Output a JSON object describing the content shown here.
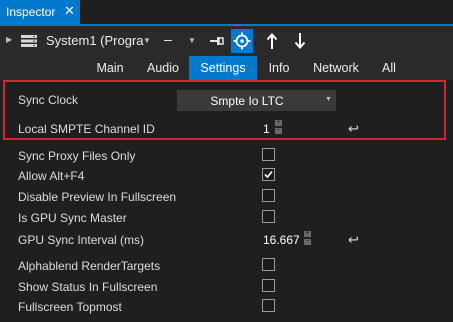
{
  "window": {
    "title": "Inspector",
    "close_glyph": "✕"
  },
  "toolbar": {
    "system_label": "System1 (Progra",
    "dash_label": "–",
    "icons": [
      "expand-arrow-icon",
      "device-icon",
      "dropdown-caret-icon",
      "pin-icon",
      "target-icon",
      "arrow-up-icon",
      "arrow-down-icon"
    ]
  },
  "tabs": [
    {
      "label": "Main"
    },
    {
      "label": "Audio"
    },
    {
      "label": "Settings",
      "active": true
    },
    {
      "label": "Info"
    },
    {
      "label": "Network"
    },
    {
      "label": "All"
    }
  ],
  "properties": {
    "sync_clock": {
      "label": "Sync Clock",
      "value": "Smpte Io LTC"
    },
    "local_smpte": {
      "label": "Local SMPTE Channel ID",
      "value": "1"
    },
    "sync_proxy": {
      "label": "Sync Proxy Files Only",
      "checked": false
    },
    "allow_alt_f4": {
      "label": "Allow Alt+F4",
      "checked": true
    },
    "disable_preview": {
      "label": "Disable Preview In Fullscreen",
      "checked": false
    },
    "gpu_sync_master": {
      "label": "Is GPU Sync Master",
      "checked": false
    },
    "gpu_sync_interval": {
      "label": "GPU Sync Interval (ms)",
      "value": "16.667"
    },
    "alphablend": {
      "label": "Alphablend RenderTargets",
      "checked": false
    },
    "show_status": {
      "label": "Show Status In Fullscreen",
      "checked": false
    },
    "fullscreen_topmost": {
      "label": "Fullscreen Topmost",
      "checked": false
    }
  },
  "colors": {
    "accent": "#007acc",
    "highlight_border": "#d22630",
    "background": "#1f1f1f"
  }
}
